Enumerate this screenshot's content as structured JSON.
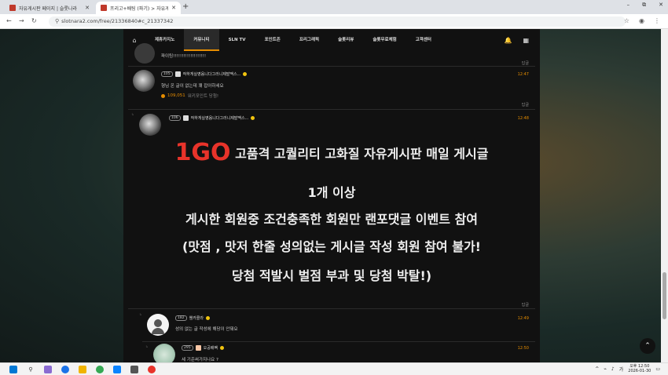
{
  "browser": {
    "tabs": [
      {
        "title": "자유게시판 페이지 | 슬롯나라",
        "active": false
      },
      {
        "title": "프리고+배팅 (파기) > 자유게시",
        "active": true
      }
    ],
    "url": "slotnara2.com/free/21336840#c_21337342",
    "win_min": "–",
    "win_max": "⧉",
    "win_close": "✕"
  },
  "site_nav": {
    "items": [
      "제휴카지노",
      "커뮤니티",
      "SLN TV",
      "포인트존",
      "프리그래픽",
      "슬롯리뷰",
      "슬롯무료체험",
      "고객센터"
    ],
    "active_index": 1
  },
  "comments": {
    "c0": {
      "text": "파이팅!!!!!!!!!!!!!!!!!!!",
      "reply": "답글"
    },
    "c1": {
      "level": "105",
      "name": "작하게실영음니다그러니제발맥스...",
      "time": "12:47",
      "text": "형님 온 글이 없는데 꽤 잡아하세요",
      "points": "109,051",
      "points_label": "워키포인트 당첨!",
      "reply": "답글"
    },
    "c2": {
      "level": "106",
      "name": "작하게실영음니다그러니제발맥스...",
      "time": "12:48",
      "reply": "답글",
      "brand": "1GO",
      "headline": "고품격 고퀄리티 고화질 자유게시판 매일 게시글",
      "line1": "1개 이상",
      "line2": "게시한 회원중 조건충족한 회원만 랜포댓글 이벤트 참여",
      "line3": "(맛점 , 맛저 한줄 성의없는 게시글 작성 회원 참여 불가!",
      "line4": "당첨 적발시 벌점 부과 및 당첨 박탈!)"
    },
    "c3": {
      "level": "182",
      "name": "웬카콜라",
      "time": "12:49",
      "text": "성의 없는 글 작성에 해당이 안돼요"
    },
    "c4": {
      "level": "295",
      "name": "오공배팩",
      "time": "12:50",
      "text": "세 기준써가지나요 ?"
    }
  },
  "taskbar": {
    "time": "오후 12:50",
    "date": "2026-01-30"
  },
  "colors": {
    "accent": "#e58c00",
    "brand_red": "#e8332a",
    "panel": "#111111"
  }
}
